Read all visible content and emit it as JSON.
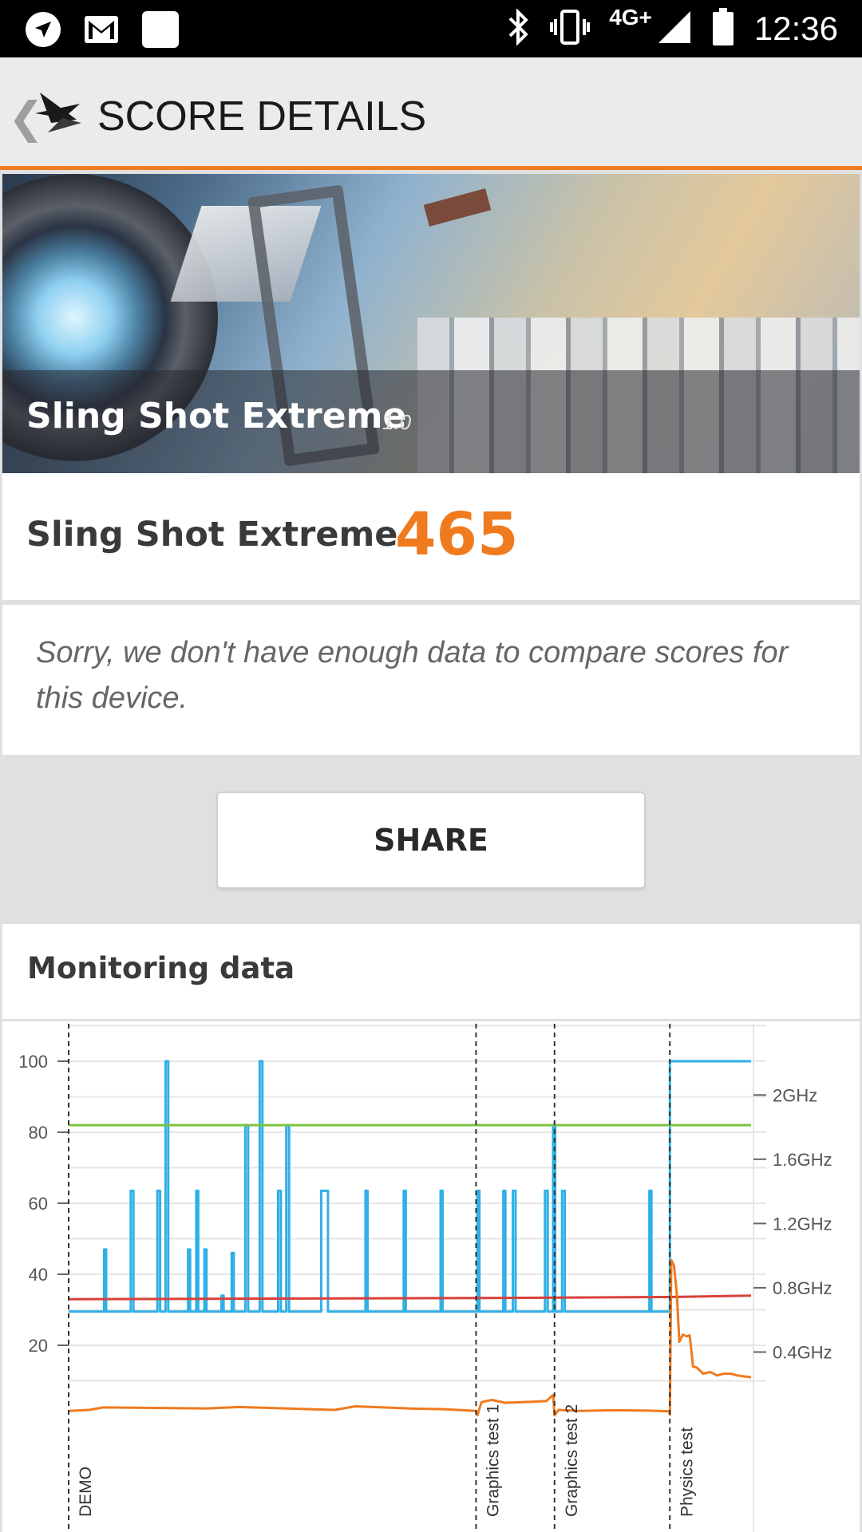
{
  "status_bar": {
    "time": "12:36",
    "network": "4G+",
    "left_icons": [
      "send-icon",
      "gmail-icon",
      "blank-notification-icon"
    ],
    "right_icons": [
      "bluetooth-icon",
      "vibrate-icon",
      "signal-icon",
      "battery-icon"
    ]
  },
  "app_bar": {
    "title": "SCORE DETAILS",
    "back_icon": "chevron-left-icon",
    "logo_icon": "3dmark-logo-icon",
    "accent_color": "#f07a1e"
  },
  "hero": {
    "title": "Sling Shot Extreme",
    "version": "1.0"
  },
  "score": {
    "label": "Sling Shot Extreme",
    "value": "465",
    "value_color": "#f07a1e"
  },
  "notice": {
    "text": "Sorry, we don't have enough data to compare scores for this device."
  },
  "share": {
    "label": "SHARE"
  },
  "monitoring": {
    "title": "Monitoring data"
  },
  "chart_data": {
    "type": "line",
    "title": "",
    "xlabel": "",
    "ylabel": "",
    "ylim": [
      0,
      110
    ],
    "left_ticks": [
      "100",
      "80",
      "60",
      "40",
      "20"
    ],
    "left_tick_values": [
      100,
      80,
      60,
      40,
      20
    ],
    "right_ticks": [
      "2GHz",
      "1.6GHz",
      "1.2GHz",
      "0.8GHz",
      "0.4GHz"
    ],
    "right_tick_values_ghz": [
      2.0,
      1.6,
      1.2,
      0.8,
      0.4
    ],
    "grid": true,
    "x_range": [
      0,
      100
    ],
    "markers": [
      {
        "label": "DEMO",
        "x": 0
      },
      {
        "label": "Graphics test 1",
        "x": 59.7
      },
      {
        "label": "Graphics test 2",
        "x": 71.2
      },
      {
        "label": "Physics test",
        "x": 88.1
      }
    ],
    "series": [
      {
        "color": "#2fb0e6",
        "x": [
          0,
          5.2,
          5.2,
          5.5,
          5.5,
          9.1,
          9.1,
          9.5,
          9.5,
          13.0,
          13.0,
          13.4,
          13.4,
          14.2,
          14.2,
          14.6,
          14.6,
          17.5,
          17.5,
          17.8,
          17.8,
          18.7,
          18.7,
          19.0,
          19.0,
          19.9,
          19.9,
          20.2,
          20.2,
          22.4,
          22.4,
          22.7,
          22.7,
          23.9,
          23.9,
          24.2,
          24.2,
          25.9,
          25.9,
          26.3,
          26.3,
          28.0,
          28.0,
          28.4,
          28.4,
          30.7,
          30.7,
          31.1,
          31.1,
          31.9,
          31.9,
          32.3,
          32.3,
          37.0,
          37.0,
          38.0,
          38.0,
          43.5,
          43.5,
          43.8,
          43.8,
          49.1,
          49.1,
          49.4,
          49.4,
          54.5,
          54.5,
          54.8,
          54.8,
          59.9,
          59.9,
          60.2,
          60.2,
          63.7,
          63.7,
          64.0,
          64.0,
          65.1,
          65.1,
          65.5,
          65.5,
          69.8,
          69.8,
          70.2,
          70.2,
          71.0,
          71.0,
          71.3,
          71.3,
          72.3,
          72.3,
          72.7,
          72.7,
          85.1,
          85.1,
          85.4,
          85.4,
          88.1,
          88.1,
          100
        ],
        "values": [
          29.5,
          29.5,
          47,
          47,
          29.5,
          29.5,
          63.5,
          63.5,
          29.5,
          29.5,
          63.5,
          63.5,
          29.5,
          29.5,
          100,
          100,
          29.5,
          29.5,
          47,
          47,
          29.5,
          29.5,
          63.5,
          63.5,
          29.5,
          29.5,
          47,
          47,
          29.5,
          29.5,
          34,
          34,
          29.5,
          29.5,
          46,
          46,
          29.5,
          29.5,
          82,
          82,
          29.5,
          29.5,
          100,
          100,
          29.5,
          29.5,
          63.5,
          63.5,
          29.5,
          29.5,
          82,
          82,
          29.5,
          29.5,
          63.5,
          63.5,
          29.5,
          29.5,
          63.5,
          63.5,
          29.5,
          29.5,
          63.5,
          63.5,
          29.5,
          29.5,
          63.5,
          63.5,
          29.5,
          29.5,
          63.5,
          63.5,
          29.5,
          29.5,
          63.5,
          63.5,
          29.5,
          29.5,
          63.5,
          63.5,
          29.5,
          29.5,
          63.5,
          63.5,
          29.5,
          29.5,
          82,
          82,
          29.5,
          29.5,
          63.5,
          63.5,
          29.5,
          29.5,
          63.5,
          63.5,
          29.5,
          29.5,
          100,
          100
        ]
      },
      {
        "color": "#7dc142",
        "x": [
          0,
          100
        ],
        "values": [
          82,
          82
        ]
      },
      {
        "color": "#d8403a",
        "x": [
          0,
          60,
          88,
          100
        ],
        "values": [
          33,
          33.3,
          33.6,
          34
        ]
      },
      {
        "color": "#f07a1e",
        "x": [
          0,
          3,
          5,
          20,
          25,
          39,
          42,
          50,
          55,
          59.7,
          59.9,
          60.5,
          62,
          64,
          68,
          70,
          71.0,
          71.2,
          71.8,
          75,
          80,
          85,
          88.0,
          88.1,
          88.3,
          88.7,
          89.1,
          89.5,
          90.0,
          90.6,
          91.0,
          91.5,
          92.0,
          93.0,
          94.0,
          95.0,
          96.0,
          97.0,
          98.0,
          100
        ],
        "values": [
          1.5,
          1.8,
          2.5,
          2.2,
          2.6,
          1.8,
          2.8,
          2.2,
          2.0,
          1.5,
          0.3,
          4.0,
          4.6,
          3.8,
          4.1,
          4.3,
          6.0,
          0.3,
          1.8,
          1.5,
          1.7,
          1.6,
          1.4,
          0.5,
          44,
          42.5,
          35,
          21,
          23,
          22.5,
          22.8,
          14,
          13.8,
          12,
          12.5,
          11.5,
          12,
          12,
          11.5,
          11
        ]
      }
    ]
  }
}
